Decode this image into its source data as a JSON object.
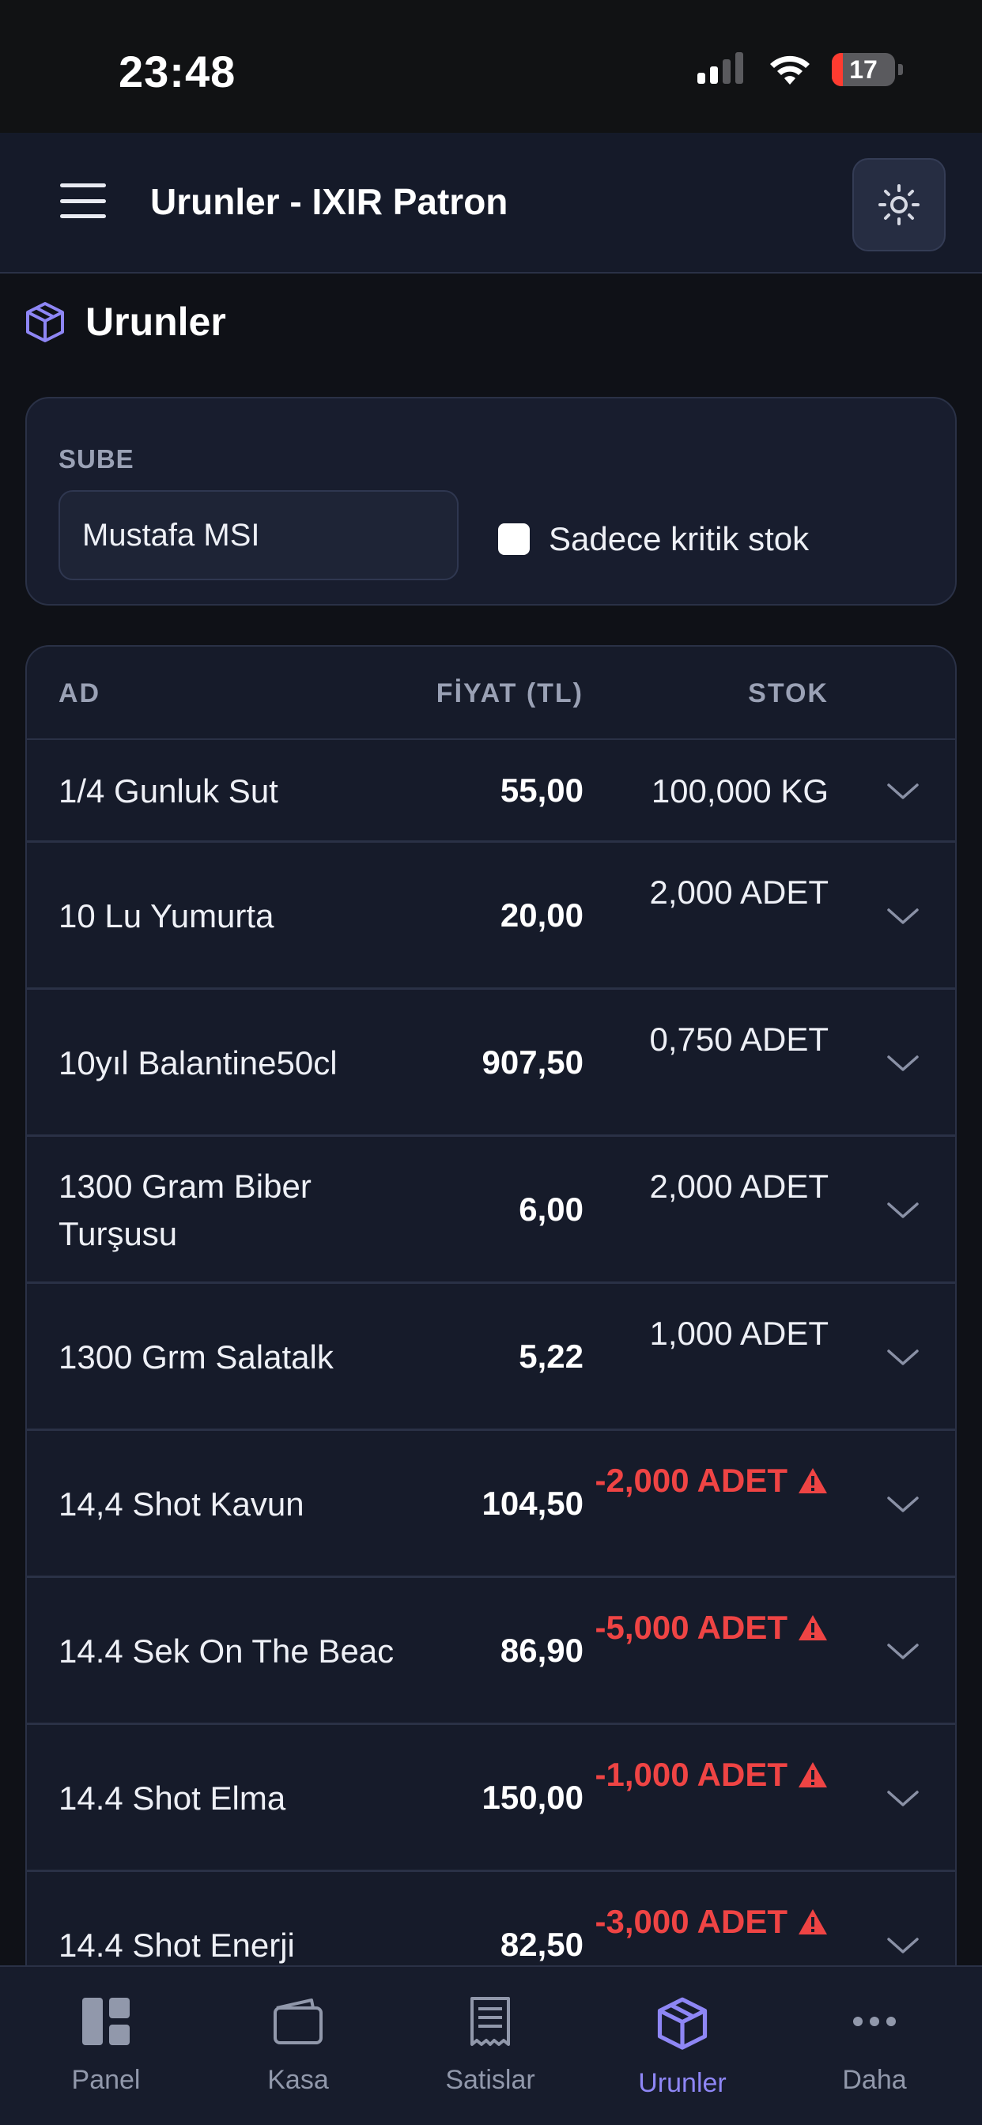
{
  "status_bar": {
    "time": "23:48",
    "battery": "17",
    "battery_level": 0.17
  },
  "header": {
    "title": "Urunler - IXIR Patron"
  },
  "page": {
    "title": "Urunler"
  },
  "filter": {
    "branch_label": "SUBE",
    "branch_value": "Mustafa MSI",
    "critical_label": "Sadece kritik stok",
    "critical_checked": false
  },
  "table": {
    "headers": {
      "name": "AD",
      "price": "FİYAT (TL)",
      "stock": "STOK"
    },
    "rows": [
      {
        "name": "1/4 Gunluk Sut",
        "price": "55,00",
        "stock": "100,000 KG",
        "critical": false
      },
      {
        "name": "10 Lu Yumurta",
        "price": "20,00",
        "stock": "2,000 ADET",
        "critical": false
      },
      {
        "name": "10yıl Balantine50cl",
        "price": "907,50",
        "stock": "0,750 ADET",
        "critical": false
      },
      {
        "name": "1300 Gram Biber Turşusu",
        "price": "6,00",
        "stock": "2,000 ADET",
        "critical": false
      },
      {
        "name": "1300 Grm Salatalk",
        "price": "5,22",
        "stock": "1,000 ADET",
        "critical": false
      },
      {
        "name": "14,4 Shot Kavun",
        "price": "104,50",
        "stock": "-2,000 ADET",
        "critical": true
      },
      {
        "name": "14.4 Sek On The Beac",
        "price": "86,90",
        "stock": "-5,000 ADET",
        "critical": true
      },
      {
        "name": "14.4 Shot Elma",
        "price": "150,00",
        "stock": "-1,000 ADET",
        "critical": true
      },
      {
        "name": "14.4 Shot Enerji",
        "price": "82,50",
        "stock": "-3,000 ADET",
        "critical": true
      }
    ]
  },
  "bottom_nav": [
    {
      "label": "Panel",
      "icon": "dashboard-icon",
      "active": false
    },
    {
      "label": "Kasa",
      "icon": "wallet-icon",
      "active": false
    },
    {
      "label": "Satislar",
      "icon": "receipt-icon",
      "active": false
    },
    {
      "label": "Urunler",
      "icon": "box-icon",
      "active": true
    },
    {
      "label": "Daha",
      "icon": "more-icon",
      "active": false
    }
  ],
  "colors": {
    "accent": "#8e86f5",
    "critical": "#ef4444",
    "background": "#0f1117",
    "surface": "#161b2a"
  }
}
